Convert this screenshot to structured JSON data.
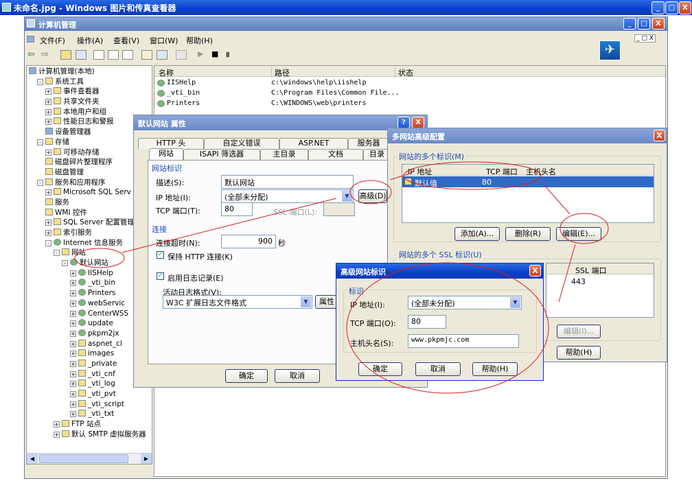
{
  "viewer": {
    "title": "未命名.jpg - Windows 图片和传真查看器",
    "min": "_",
    "max": "□",
    "close": "X"
  },
  "mmc": {
    "title": "计算机管理",
    "menu": [
      {
        "label": "文件(F)"
      },
      {
        "label": "操作(A)"
      },
      {
        "label": "查看(V)"
      },
      {
        "label": "窗口(W)"
      },
      {
        "label": "帮助(H)"
      }
    ]
  },
  "tree": {
    "items": [
      {
        "label": "计算机管理(本地)",
        "indent": 0,
        "icon": "pc",
        "exp": ""
      },
      {
        "label": "系统工具",
        "indent": 1,
        "icon": "tool",
        "exp": "-"
      },
      {
        "label": "事件查看器",
        "indent": 2,
        "icon": "log",
        "exp": "+"
      },
      {
        "label": "共享文件夹",
        "indent": 2,
        "icon": "folder",
        "exp": "+"
      },
      {
        "label": "本地用户和组",
        "indent": 2,
        "icon": "users",
        "exp": "+"
      },
      {
        "label": "性能日志和警报",
        "indent": 2,
        "icon": "perf",
        "exp": "+"
      },
      {
        "label": "设备管理器",
        "indent": 2,
        "icon": "pc",
        "exp": ""
      },
      {
        "label": "存储",
        "indent": 1,
        "icon": "disk",
        "exp": "-"
      },
      {
        "label": "可移动存储",
        "indent": 2,
        "icon": "disk",
        "exp": "+"
      },
      {
        "label": "磁盘碎片整理程序",
        "indent": 2,
        "icon": "disk",
        "exp": ""
      },
      {
        "label": "磁盘管理",
        "indent": 2,
        "icon": "disk",
        "exp": ""
      },
      {
        "label": "服务和应用程序",
        "indent": 1,
        "icon": "svc",
        "exp": "-"
      },
      {
        "label": "Microsoft SQL Serv",
        "indent": 2,
        "icon": "db",
        "exp": "+"
      },
      {
        "label": "服务",
        "indent": 2,
        "icon": "gear",
        "exp": ""
      },
      {
        "label": "WMI 控件",
        "indent": 2,
        "icon": "gear",
        "exp": ""
      },
      {
        "label": "SQL Server 配置管理",
        "indent": 2,
        "icon": "db",
        "exp": "+"
      },
      {
        "label": "索引服务",
        "indent": 2,
        "icon": "svc",
        "exp": "+"
      },
      {
        "label": "Internet 信息服务",
        "indent": 2,
        "icon": "globe",
        "exp": "-"
      },
      {
        "label": "网站",
        "indent": 3,
        "icon": "folder",
        "exp": "-"
      },
      {
        "label": "默认网站",
        "indent": 4,
        "icon": "globe",
        "exp": "-"
      },
      {
        "label": "IISHelp",
        "indent": 5,
        "icon": "globe",
        "exp": "+"
      },
      {
        "label": "_vti_bin",
        "indent": 5,
        "icon": "globe",
        "exp": "+"
      },
      {
        "label": "Printers",
        "indent": 5,
        "icon": "globe",
        "exp": "+"
      },
      {
        "label": "webServic",
        "indent": 5,
        "icon": "globe",
        "exp": "+"
      },
      {
        "label": "CenterWSS",
        "indent": 5,
        "icon": "globe",
        "exp": "+"
      },
      {
        "label": "update",
        "indent": 5,
        "icon": "globe",
        "exp": "+"
      },
      {
        "label": "pkpm2jx",
        "indent": 5,
        "icon": "globe",
        "exp": "+"
      },
      {
        "label": "aspnet_cl",
        "indent": 5,
        "icon": "folder",
        "exp": "+"
      },
      {
        "label": "images",
        "indent": 5,
        "icon": "folder",
        "exp": "+"
      },
      {
        "label": "_private",
        "indent": 5,
        "icon": "folder",
        "exp": "+"
      },
      {
        "label": "_vti_cnf",
        "indent": 5,
        "icon": "folder",
        "exp": "+"
      },
      {
        "label": "_vti_log",
        "indent": 5,
        "icon": "folder",
        "exp": "+"
      },
      {
        "label": "_vti_pvt",
        "indent": 5,
        "icon": "folder",
        "exp": "+"
      },
      {
        "label": "_vti_script",
        "indent": 5,
        "icon": "folder",
        "exp": "+"
      },
      {
        "label": "_vti_txt",
        "indent": 5,
        "icon": "folder",
        "exp": "+"
      },
      {
        "label": "FTP 站点",
        "indent": 3,
        "icon": "folder",
        "exp": "+"
      },
      {
        "label": "默认 SMTP 虚拟服务器",
        "indent": 3,
        "icon": "mail",
        "exp": "+"
      }
    ]
  },
  "list": {
    "headers": [
      "名称",
      "路径",
      "状态"
    ],
    "rows": [
      {
        "name": "IISHelp",
        "path": "c:\\windows\\help\\iishelp"
      },
      {
        "name": "_vti_bin",
        "path": "C:\\Program Files\\Common File..."
      },
      {
        "name": "Printers",
        "path": "C:\\WINDOWS\\web\\printers"
      }
    ]
  },
  "props": {
    "title": "默认网站 属性",
    "help": "?",
    "close": "X",
    "tabs_back": [
      "HTTP 头",
      "自定义错误",
      "ASP.NET",
      "服务器"
    ],
    "tabs_front": [
      "网站",
      "ISAPI 筛选器",
      "主目录",
      "文档",
      "目录"
    ],
    "group_id": "网站标识",
    "desc_label": "描述(S):",
    "desc_value": "默认网站",
    "ip_label": "IP 地址(I):",
    "ip_value": "(全部未分配)",
    "adv_btn": "高级(D)",
    "port_label": "TCP 端口(T):",
    "port_value": "80",
    "ssl_label": "SSL 端口(L):",
    "group_conn": "连接",
    "timeout_label": "连接超时(N):",
    "timeout_value": "900",
    "timeout_unit": "秒",
    "keepalive": "保持 HTTP 连接(K)",
    "log_enable": "启用日志记录(E)",
    "log_format_label": "活动日志格式(V):",
    "log_format_value": "W3C 扩展日志文件格式",
    "prop_btn": "属性",
    "ok": "确定",
    "cancel": "取消"
  },
  "multi": {
    "title": "多网站高级配置",
    "close": "X",
    "group1": "网站的多个标识(M)",
    "headers": [
      "IP 地址",
      "TCP 端口",
      "主机头名"
    ],
    "row": {
      "ip": "默认值",
      "port": "80",
      "host": ""
    },
    "add": "添加(A)...",
    "remove": "删除(R)",
    "edit": "编辑(E)...",
    "group2": "网站的多个 SSL 标识(U)",
    "ssl_header": "SSL 端口",
    "ssl_value": "443",
    "edit2": "编辑(I)...",
    "help": "帮助(H)"
  },
  "advid": {
    "title": "高级网站标识",
    "close": "X",
    "group": "标识",
    "ip_label": "IP 地址(I):",
    "ip_value": "(全部未分配)",
    "port_label": "TCP 端口(O):",
    "port_value": "80",
    "host_label": "主机头名(S):",
    "host_value": "www.pkpmjc.com",
    "ok": "确定",
    "cancel": "取消",
    "help": "帮助(H)"
  }
}
